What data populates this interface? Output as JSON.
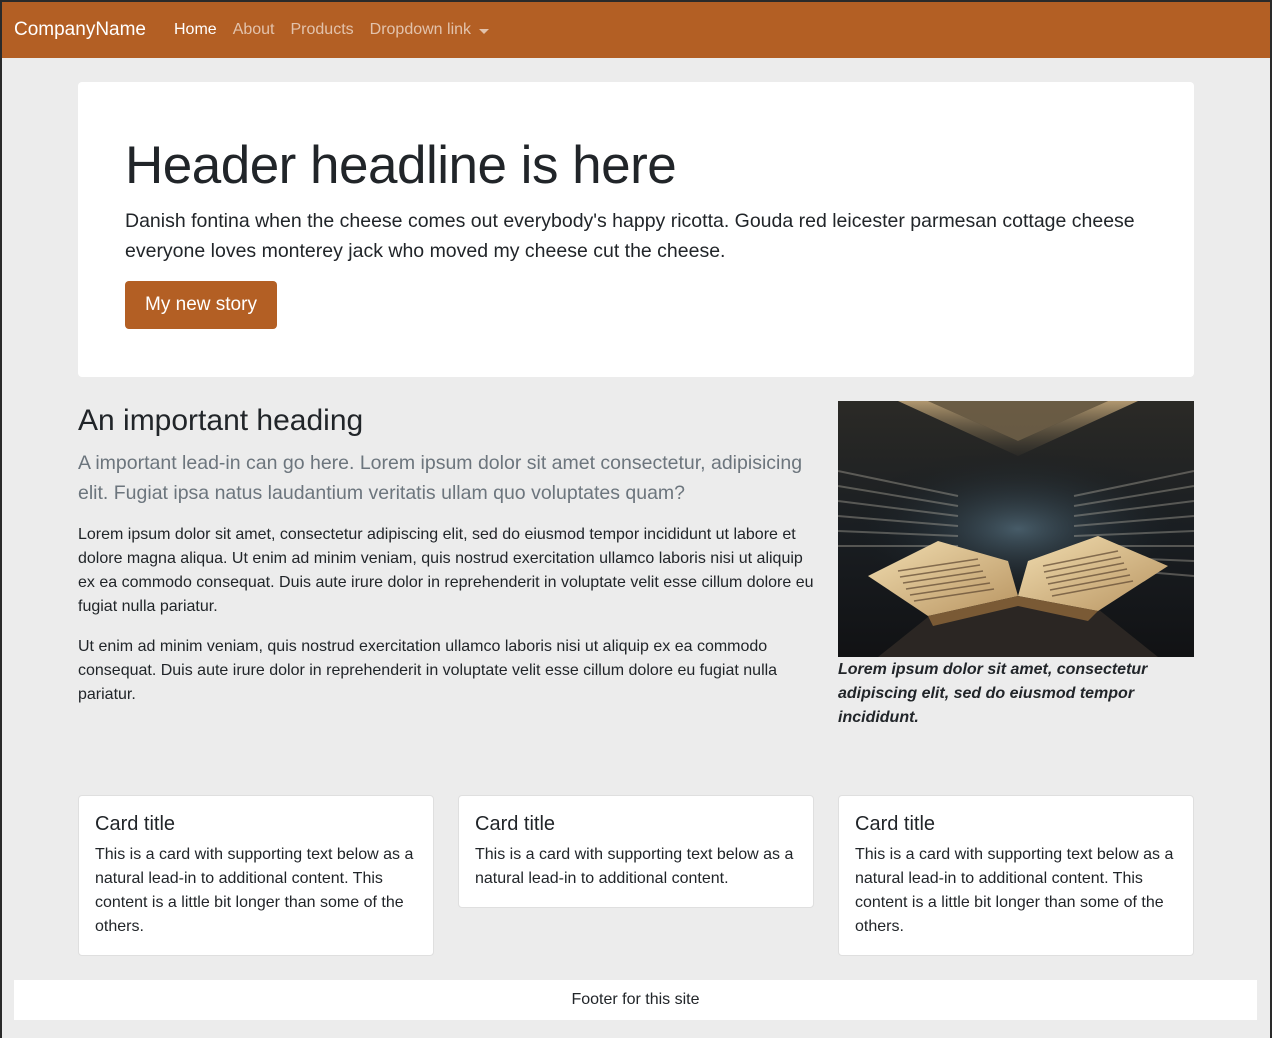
{
  "navbar": {
    "brand": "CompanyName",
    "links": [
      {
        "label": "Home"
      },
      {
        "label": "About"
      },
      {
        "label": "Products"
      },
      {
        "label": "Dropdown link"
      }
    ],
    "background": "#b35f24"
  },
  "hero": {
    "title": "Header headline is here",
    "text": "Danish fontina when the cheese comes out everybody's happy ricotta. Gouda red leicester parmesan cottage cheese everyone loves monterey jack who moved my cheese cut the cheese.",
    "button_label": "My new story"
  },
  "main": {
    "heading": "An important heading",
    "lead": "A important lead-in can go here. Lorem ipsum dolor sit amet consectetur, adipisicing elit. Fugiat ipsa natus laudantium veritatis ullam quo voluptates quam?",
    "paragraphs": [
      "Lorem ipsum dolor sit amet, consectetur adipiscing elit, sed do eiusmod tempor incididunt ut labore et dolore magna aliqua. Ut enim ad minim veniam, quis nostrud exercitation ullamco laboris nisi ut aliquip ex ea commodo consequat. Duis aute irure dolor in reprehenderit in voluptate velit esse cillum dolore eu fugiat nulla pariatur.",
      "Ut enim ad minim veniam, quis nostrud exercitation ullamco laboris nisi ut aliquip ex ea commodo consequat. Duis aute irure dolor in reprehenderit in voluptate velit esse cillum dolore eu fugiat nulla pariatur."
    ]
  },
  "figure": {
    "caption": "Lorem ipsum dolor sit amet, consectetur adipiscing elit, sed do eiusmod tempor incididunt."
  },
  "cards": [
    {
      "title": "Card title",
      "text": "This is a card with supporting text below as a natural lead-in to additional content. This content is a little bit longer than some of the others."
    },
    {
      "title": "Card title",
      "text": "This is a card with supporting text below as a natural lead-in to additional content."
    },
    {
      "title": "Card title",
      "text": "This is a card with supporting text below as a natural lead-in to additional content. This content is a little bit longer than some of the others."
    }
  ],
  "footer": {
    "text": "Footer for this site"
  }
}
